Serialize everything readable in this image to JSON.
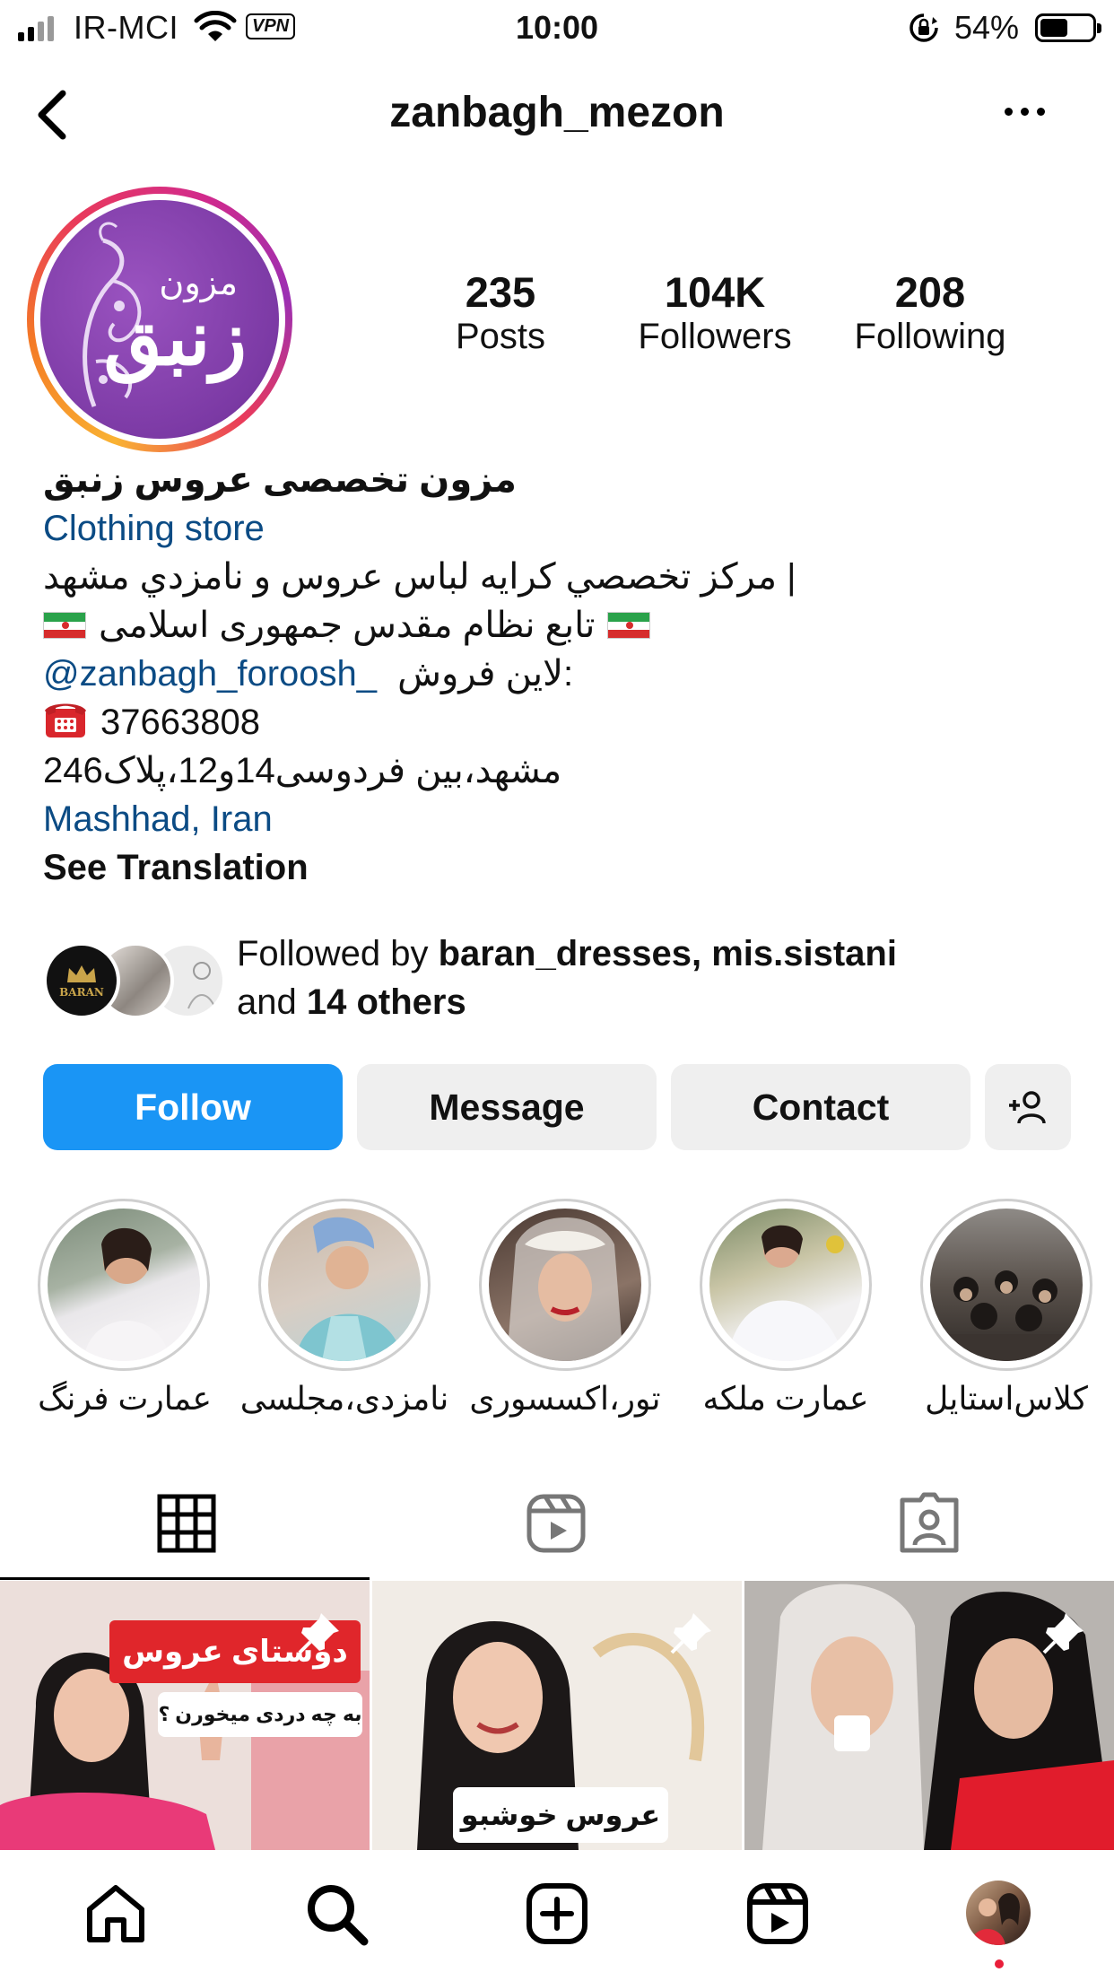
{
  "status_bar": {
    "carrier": "IR-MCI",
    "vpn": "VPN",
    "time": "10:00",
    "battery_percent": "54%",
    "battery_level": 0.54
  },
  "header": {
    "username": "zanbagh_mezon"
  },
  "avatar": {
    "logo_text_small": "مزون",
    "logo_text_large": "زنبق"
  },
  "stats": {
    "posts": {
      "value": "235",
      "label": "Posts"
    },
    "followers": {
      "value": "104K",
      "label": "Followers"
    },
    "following": {
      "value": "208",
      "label": "Following"
    }
  },
  "bio": {
    "name": "مزون تخصصی عروس زنبق",
    "category": "Clothing store",
    "line1": "مرکز تخصصي کرايه لباس عروس و نامزدي مشهد |",
    "line2": "تابع نظام مقدس جمهوری اسلامی",
    "line3_label": "لاین فروش:",
    "line3_handle": "@zanbagh_foroosh_",
    "phone": "37663808",
    "address": "مشهد،بین فردوسی14و12،پلاک246",
    "location": "Mashhad, Iran",
    "see_translation": "See Translation"
  },
  "followed_by": {
    "prefix": "Followed by",
    "users": "baran_dresses, mis.sistani",
    "and": "and",
    "others": "14 others",
    "avatar1_text": "BARAN"
  },
  "buttons": {
    "follow": "Follow",
    "message": "Message",
    "contact": "Contact"
  },
  "highlights": [
    {
      "label": "عمارت فرنگ"
    },
    {
      "label": "نامزدی،مجلسی"
    },
    {
      "label": "تور،اکسسوری"
    },
    {
      "label": "عمارت ملکه"
    },
    {
      "label": "کلاس‌استایل"
    }
  ],
  "posts": [
    {
      "banner": "دوستای عروس",
      "subtitle": "به چه دردی میخورن ؟"
    },
    {
      "banner": "عروس خوشبو"
    },
    {
      "banner": ""
    }
  ],
  "colors": {
    "follow_button": "#1a95f5",
    "link": "#0b4b84",
    "secondary_button": "#efefef"
  }
}
